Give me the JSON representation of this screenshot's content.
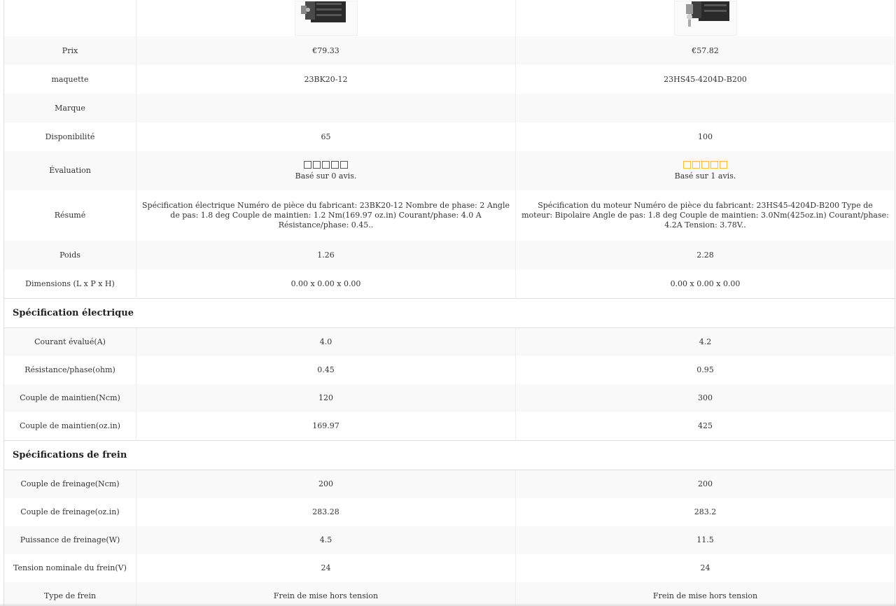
{
  "products": [
    {
      "image_alt": "23BK20-12 stepper motor with brake",
      "price": "€79.33",
      "model": "23BK20-12",
      "brand": "",
      "availability": "65",
      "rating_stars": 0,
      "rating_text": "Basé sur 0 avis.",
      "summary": "Spécification électrique Numéro de pièce du fabricant: 23BK20-12 Nombre de phase: 2 Angle de pas: 1.8 deg Couple de maintien: 1.2 Nm(169.97 oz.in) Courant/phase: 4.0 A Résistance/phase: 0.45..",
      "weight": "1.26",
      "dimensions": "0.00 x 0.00 x 0.00",
      "rated_current": "4.0",
      "resistance_phase": "0.45",
      "holding_torque_ncm": "120",
      "holding_torque_ozin": "169.97",
      "braking_torque_ncm": "200",
      "braking_torque_ozin": "283.28",
      "braking_power": "4.5",
      "brake_voltage": "24",
      "brake_type": "Frein de mise hors tension"
    },
    {
      "image_alt": "23HS45-4204D-B200 stepper motor with brake",
      "price": "€57.82",
      "model": "23HS45-4204D-B200",
      "brand": "",
      "availability": "100",
      "rating_stars": 5,
      "rating_text": "Basé sur 1 avis.",
      "summary": "Spécification du moteur Numéro de pièce du fabricant: 23HS45-4204D-B200 Type de moteur: Bipolaire Angle de pas: 1.8 deg Couple de maintien: 3.0Nm(425oz.in) Courant/phase: 4.2A Tension: 3.78V..",
      "weight": "2.28",
      "dimensions": "0.00 x 0.00 x 0.00",
      "rated_current": "4.2",
      "resistance_phase": "0.95",
      "holding_torque_ncm": "300",
      "holding_torque_ozin": "425",
      "braking_torque_ncm": "200",
      "braking_torque_ozin": "283.2",
      "braking_power": "11.5",
      "brake_voltage": "24",
      "brake_type": "Frein de mise hors tension"
    }
  ],
  "labels": {
    "price": "Prix",
    "model": "maquette",
    "brand": "Marque",
    "availability": "Disponibilité",
    "rating": "Évaluation",
    "summary": "Résumé",
    "weight": "Poids",
    "dimensions": "Dimensions (L x P x H)",
    "rated_current": "Courant évalué(A)",
    "resistance_phase": "Résistance/phase(ohm)",
    "holding_torque_ncm": "Couple de maintien(Ncm)",
    "holding_torque_ozin": "Couple de maintien(oz.in)",
    "braking_torque_ncm": "Couple de freinage(Ncm)",
    "braking_torque_ozin": "Couple de freinage(oz.in)",
    "braking_power": "Puissance de freinage(W)",
    "brake_voltage": "Tension nominale du frein(V)",
    "brake_type": "Type de frein"
  },
  "sections": {
    "electrical": "Spécification électrique",
    "brake": "Spécifications de frein"
  },
  "colors": {
    "star_empty": "#555555",
    "star_rated": "#f3c23a",
    "row_alt": "#f9f9f9"
  }
}
